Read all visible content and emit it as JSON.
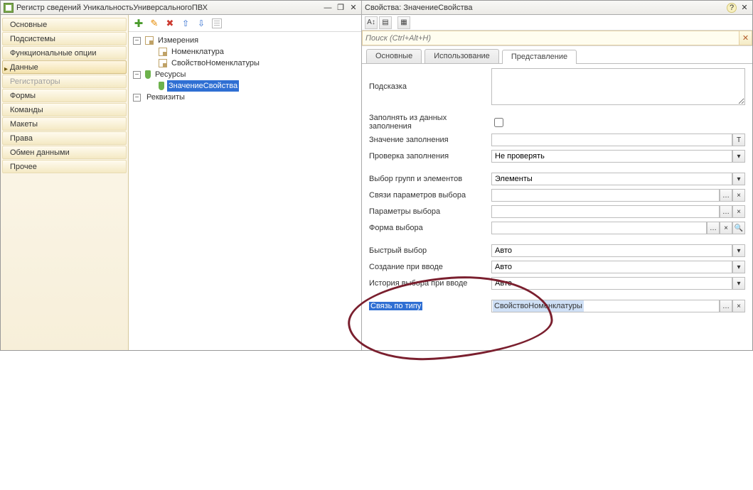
{
  "left": {
    "title": "Регистр сведений УникальностьУниверсальногоПВХ",
    "nav": [
      {
        "label": "Основные",
        "dim": false
      },
      {
        "label": "Подсистемы",
        "dim": false
      },
      {
        "label": "Функциональные опции",
        "dim": false
      },
      {
        "label": "Данные",
        "dim": false,
        "active": true
      },
      {
        "label": "Регистраторы",
        "dim": true
      },
      {
        "label": "Формы",
        "dim": false
      },
      {
        "label": "Команды",
        "dim": false
      },
      {
        "label": "Макеты",
        "dim": false
      },
      {
        "label": "Права",
        "dim": false
      },
      {
        "label": "Обмен данными",
        "dim": false
      },
      {
        "label": "Прочее",
        "dim": false
      }
    ],
    "tree": {
      "dimensions": "Измерения",
      "dim1": "Номенклатура",
      "dim2": "СвойствоНоменклатуры",
      "resources": "Ресурсы",
      "res1": "ЗначениеСвойства",
      "attributes": "Реквизиты"
    }
  },
  "right": {
    "title": "Свойства: ЗначениеСвойства",
    "search_placeholder": "Поиск (Ctrl+Alt+H)",
    "tabs": {
      "t1": "Основные",
      "t2": "Использование",
      "t3": "Представление"
    },
    "labels": {
      "hint": "Подсказка",
      "fillFromData": "Заполнять из данных заполнения",
      "fillValue": "Значение заполнения",
      "fillCheck": "Проверка заполнения",
      "groupPick": "Выбор групп и элементов",
      "paramLinks": "Связи параметров выбора",
      "pickParams": "Параметры выбора",
      "pickForm": "Форма выбора",
      "quickPick": "Быстрый выбор",
      "createOnInput": "Создание при вводе",
      "historyOnInput": "История выбора при вводе",
      "linkByType": "Связь по типу"
    },
    "values": {
      "fillCheck": "Не проверять",
      "groupPick": "Элементы",
      "quickPick": "Авто",
      "createOnInput": "Авто",
      "historyOnInput": "Авто",
      "linkByType": "СвойствоНоменклатуры"
    }
  }
}
